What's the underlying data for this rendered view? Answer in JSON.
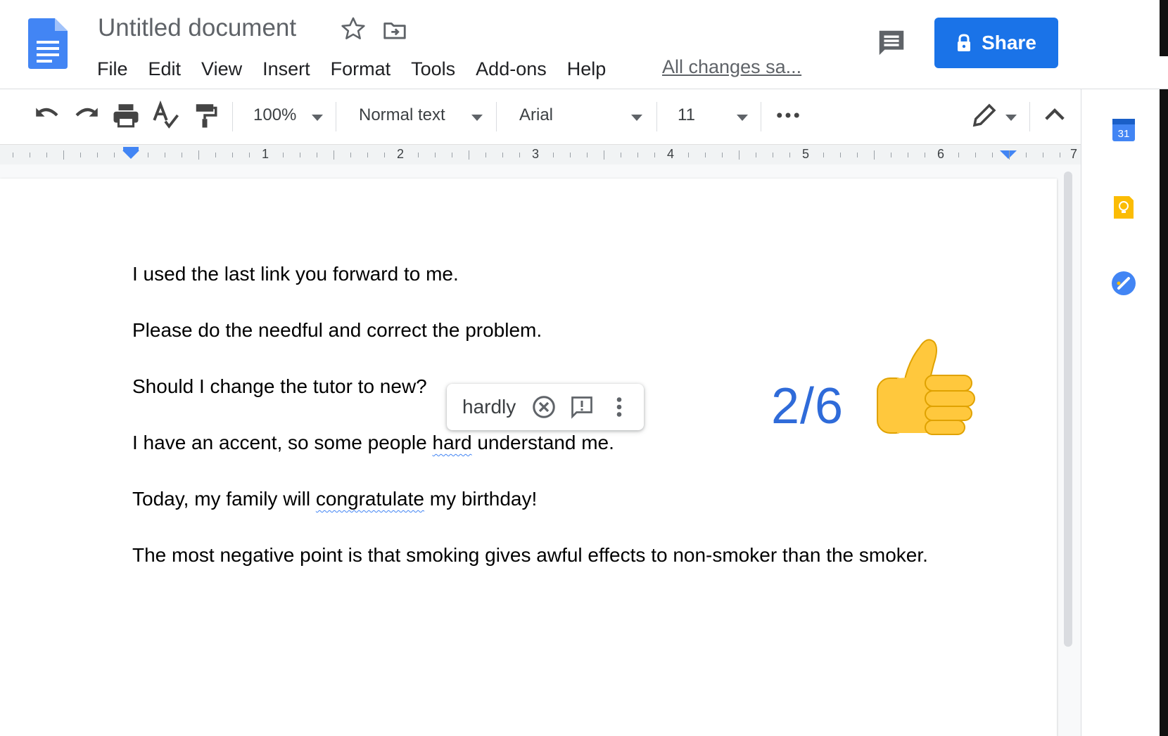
{
  "header": {
    "title": "Untitled document",
    "menu": [
      "File",
      "Edit",
      "View",
      "Insert",
      "Format",
      "Tools",
      "Add-ons",
      "Help"
    ],
    "save_status": "All changes sa...",
    "share_label": "Share"
  },
  "toolbar": {
    "zoom": "100%",
    "style": "Normal text",
    "font": "Arial",
    "size": "11"
  },
  "ruler": {
    "numbers": [
      "1",
      "2",
      "3",
      "4",
      "5",
      "6",
      "7"
    ]
  },
  "document": {
    "line1": "I used the last link you forward to me.",
    "line2": "Please do the needful and correct the problem.",
    "line3": "Should I change the tutor to new?",
    "line4_pre": "I have an accent, so some people ",
    "line4_word": "hard",
    "line4_post": " understand me.",
    "line5_pre": "Today, my family will ",
    "line5_word": "congratulate",
    "line5_post": " my birthday!",
    "line6": "The most negative point is that smoking gives awful effects to non-smoker than the smoker."
  },
  "suggestion": {
    "word": "hardly"
  },
  "overlay": {
    "score": "2/6"
  },
  "side_panel": {
    "calendar_day": "31"
  },
  "colors": {
    "accent": "#1a73e8",
    "score": "#2f6bd9",
    "typo_underline": "#4285f4"
  },
  "icons": [
    "docs-logo-icon",
    "star-icon",
    "move-to-folder-icon",
    "comment-icon",
    "lock-icon",
    "undo-icon",
    "redo-icon",
    "print-icon",
    "spellcheck-icon",
    "paint-format-icon",
    "more-icon",
    "edit-mode-pencil-icon",
    "collapse-chevron-icon",
    "dismiss-icon",
    "feedback-icon",
    "more-vert-icon",
    "thumbs-up-icon",
    "calendar-icon",
    "keep-icon",
    "tasks-icon"
  ]
}
